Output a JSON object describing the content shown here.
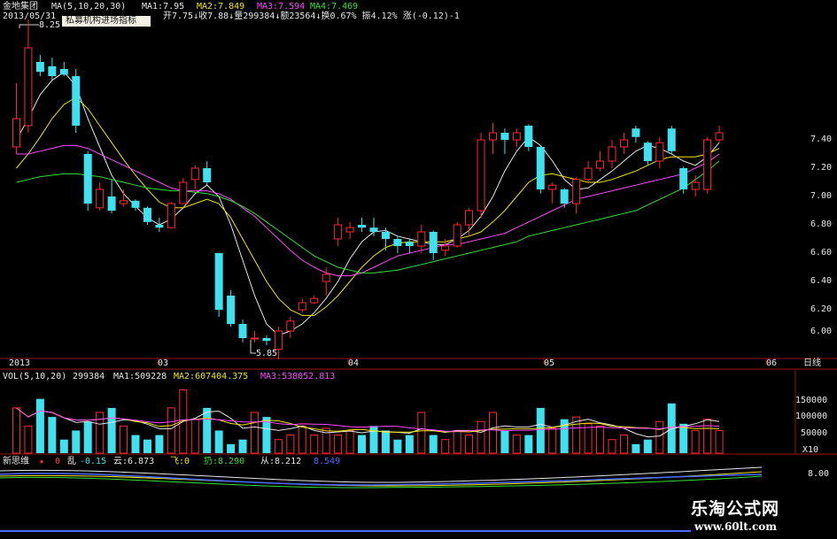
{
  "header": {
    "stock_name": "金地集团",
    "date": "2013/05/31",
    "ma_label": "MA(5,10,20,30)",
    "ma1": "MA1:7.95",
    "ma2": "MA2:7.849",
    "ma3": "MA3:7.594",
    "ma4": "MA4:7.469",
    "quote_line": "开7.75↓收7.88↓量299384↓额23564↓换0.67%  振4.12% 涨(-0.12)-1",
    "tooltip": "私募机构进场指标",
    "high_label": "8.25",
    "low_label": "5.85"
  },
  "vol_header": {
    "label": "VOL(5,10,20)",
    "value": "299384",
    "ma1": "MA1:509228",
    "ma2": "MA2:607404.375",
    "ma3": "MA3:538052.813"
  },
  "ind_header": {
    "label": "新思维",
    "star": "★",
    "zero": "0",
    "luan": "乱",
    "luan_val": "-0.15",
    "yun": "云:6.873",
    "fei": "飞:0",
    "zha": "扔:8.290",
    "cong": "从:8.212",
    "blue": "8.549"
  },
  "axis": {
    "period_label": "日线",
    "x10_label": "X10",
    "x_ticks": [
      "2013",
      "03",
      "04",
      "05",
      "06"
    ],
    "price_ticks": [
      "7.40",
      "7.20",
      "7.00",
      "6.80",
      "6.60",
      "6.40",
      "6.20",
      "6.00"
    ],
    "vol_ticks": [
      "150000",
      "100000",
      "50000"
    ],
    "ind_tick": "8.00"
  },
  "watermark": {
    "cn": "乐淘公式网",
    "url": "www.60lt.com"
  },
  "colors": {
    "up": "#ff2a2a",
    "down": "#3fe0f0",
    "ma1": "#e6e6e6",
    "ma2": "#f2e600",
    "ma3": "#ff48ff",
    "ma4": "#32e032"
  },
  "chart_data": {
    "type": "candlestick",
    "candles": [
      {
        "o": 7.35,
        "h": 7.8,
        "l": 7.3,
        "c": 7.55
      },
      {
        "o": 7.5,
        "h": 8.25,
        "l": 7.45,
        "c": 8.05
      },
      {
        "o": 7.95,
        "h": 8.0,
        "l": 7.85,
        "c": 7.88
      },
      {
        "o": 7.92,
        "h": 7.98,
        "l": 7.82,
        "c": 7.85
      },
      {
        "o": 7.9,
        "h": 7.95,
        "l": 7.85,
        "c": 7.86
      },
      {
        "o": 7.85,
        "h": 7.9,
        "l": 7.45,
        "c": 7.5
      },
      {
        "o": 7.3,
        "h": 7.32,
        "l": 6.9,
        "c": 6.95
      },
      {
        "o": 6.92,
        "h": 7.1,
        "l": 6.9,
        "c": 7.05
      },
      {
        "o": 7.0,
        "h": 7.12,
        "l": 6.88,
        "c": 6.9
      },
      {
        "o": 6.95,
        "h": 7.05,
        "l": 6.93,
        "c": 6.97
      },
      {
        "o": 6.97,
        "h": 6.98,
        "l": 6.9,
        "c": 6.92
      },
      {
        "o": 6.92,
        "h": 6.93,
        "l": 6.8,
        "c": 6.82
      },
      {
        "o": 6.8,
        "h": 6.85,
        "l": 6.75,
        "c": 6.78
      },
      {
        "o": 6.78,
        "h": 6.96,
        "l": 6.78,
        "c": 6.95
      },
      {
        "o": 6.95,
        "h": 7.13,
        "l": 6.95,
        "c": 7.1
      },
      {
        "o": 7.12,
        "h": 7.22,
        "l": 7.05,
        "c": 7.2
      },
      {
        "o": 7.2,
        "h": 7.25,
        "l": 7.08,
        "c": 7.1
      },
      {
        "o": 6.6,
        "h": 6.6,
        "l": 6.15,
        "c": 6.2
      },
      {
        "o": 6.3,
        "h": 6.34,
        "l": 6.08,
        "c": 6.1
      },
      {
        "o": 6.1,
        "h": 6.13,
        "l": 5.97,
        "c": 6.0
      },
      {
        "o": 6.0,
        "h": 6.05,
        "l": 5.97,
        "c": 6.0
      },
      {
        "o": 6.0,
        "h": 6.02,
        "l": 5.95,
        "c": 5.98
      },
      {
        "o": 5.92,
        "h": 6.08,
        "l": 5.85,
        "c": 6.05
      },
      {
        "o": 6.05,
        "h": 6.15,
        "l": 6.0,
        "c": 6.12
      },
      {
        "o": 6.2,
        "h": 6.28,
        "l": 6.18,
        "c": 6.25
      },
      {
        "o": 6.25,
        "h": 6.3,
        "l": 6.24,
        "c": 6.28
      },
      {
        "o": 6.4,
        "h": 6.5,
        "l": 6.3,
        "c": 6.45
      },
      {
        "o": 6.7,
        "h": 6.85,
        "l": 6.65,
        "c": 6.8
      },
      {
        "o": 6.75,
        "h": 6.82,
        "l": 6.7,
        "c": 6.78
      },
      {
        "o": 6.8,
        "h": 6.85,
        "l": 6.75,
        "c": 6.78
      },
      {
        "o": 6.78,
        "h": 6.85,
        "l": 6.72,
        "c": 6.75
      },
      {
        "o": 6.75,
        "h": 6.78,
        "l": 6.62,
        "c": 6.7
      },
      {
        "o": 6.7,
        "h": 6.72,
        "l": 6.6,
        "c": 6.65
      },
      {
        "o": 6.68,
        "h": 6.7,
        "l": 6.6,
        "c": 6.65
      },
      {
        "o": 6.65,
        "h": 6.8,
        "l": 6.6,
        "c": 6.75
      },
      {
        "o": 6.75,
        "h": 6.76,
        "l": 6.55,
        "c": 6.6
      },
      {
        "o": 6.62,
        "h": 6.7,
        "l": 6.58,
        "c": 6.65
      },
      {
        "o": 6.65,
        "h": 6.82,
        "l": 6.64,
        "c": 6.8
      },
      {
        "o": 6.8,
        "h": 6.92,
        "l": 6.72,
        "c": 6.9
      },
      {
        "o": 6.9,
        "h": 7.45,
        "l": 6.85,
        "c": 7.4
      },
      {
        "o": 7.4,
        "h": 7.52,
        "l": 7.3,
        "c": 7.45
      },
      {
        "o": 7.45,
        "h": 7.48,
        "l": 7.3,
        "c": 7.4
      },
      {
        "o": 7.4,
        "h": 7.48,
        "l": 7.35,
        "c": 7.45
      },
      {
        "o": 7.5,
        "h": 7.51,
        "l": 7.32,
        "c": 7.35
      },
      {
        "o": 7.35,
        "h": 7.36,
        "l": 7.02,
        "c": 7.05
      },
      {
        "o": 7.05,
        "h": 7.1,
        "l": 6.95,
        "c": 7.08
      },
      {
        "o": 7.05,
        "h": 7.06,
        "l": 6.92,
        "c": 6.95
      },
      {
        "o": 6.95,
        "h": 7.14,
        "l": 6.88,
        "c": 7.12
      },
      {
        "o": 7.12,
        "h": 7.25,
        "l": 7.1,
        "c": 7.2
      },
      {
        "o": 7.2,
        "h": 7.32,
        "l": 7.18,
        "c": 7.25
      },
      {
        "o": 7.25,
        "h": 7.4,
        "l": 7.2,
        "c": 7.35
      },
      {
        "o": 7.35,
        "h": 7.45,
        "l": 7.3,
        "c": 7.4
      },
      {
        "o": 7.48,
        "h": 7.5,
        "l": 7.38,
        "c": 7.42
      },
      {
        "o": 7.38,
        "h": 7.39,
        "l": 7.22,
        "c": 7.25
      },
      {
        "o": 7.25,
        "h": 7.42,
        "l": 7.2,
        "c": 7.38
      },
      {
        "o": 7.48,
        "h": 7.5,
        "l": 7.3,
        "c": 7.32
      },
      {
        "o": 7.2,
        "h": 7.21,
        "l": 7.02,
        "c": 7.05
      },
      {
        "o": 7.05,
        "h": 7.15,
        "l": 7.0,
        "c": 7.1
      },
      {
        "o": 7.05,
        "h": 7.42,
        "l": 7.02,
        "c": 7.4
      },
      {
        "o": 7.4,
        "h": 7.5,
        "l": 7.38,
        "c": 7.45
      }
    ],
    "ma_lines": [
      {
        "name": "MA1",
        "values": [
          7.4,
          7.55,
          7.72,
          7.82,
          7.88,
          7.78,
          7.55,
          7.35,
          7.15,
          7.02,
          6.93,
          6.85,
          6.8,
          6.84,
          6.92,
          7.02,
          7.08,
          7.0,
          6.8,
          6.55,
          6.3,
          6.1,
          6.02,
          6.05,
          6.1,
          6.18,
          6.28,
          6.4,
          6.56,
          6.68,
          6.75,
          6.76,
          6.72,
          6.7,
          6.68,
          6.66,
          6.66,
          6.7,
          6.76,
          6.86,
          7.0,
          7.18,
          7.32,
          7.42,
          7.36,
          7.25,
          7.12,
          7.05,
          7.06,
          7.12,
          7.18,
          7.25,
          7.32,
          7.36,
          7.34,
          7.3,
          7.25,
          7.22,
          7.28,
          7.38
        ]
      },
      {
        "name": "MA2",
        "values": [
          7.2,
          7.3,
          7.42,
          7.55,
          7.65,
          7.7,
          7.62,
          7.5,
          7.38,
          7.26,
          7.15,
          7.05,
          6.96,
          6.92,
          6.92,
          6.95,
          6.98,
          6.95,
          6.85,
          6.7,
          6.55,
          6.4,
          6.28,
          6.2,
          6.16,
          6.16,
          6.22,
          6.3,
          6.4,
          6.5,
          6.58,
          6.64,
          6.67,
          6.68,
          6.68,
          6.68,
          6.68,
          6.7,
          6.72,
          6.75,
          6.82,
          6.9,
          7.0,
          7.1,
          7.15,
          7.16,
          7.14,
          7.12,
          7.1,
          7.1,
          7.12,
          7.15,
          7.18,
          7.22,
          7.26,
          7.28,
          7.28,
          7.28,
          7.3,
          7.34
        ]
      },
      {
        "name": "MA3",
        "values": [
          7.3,
          7.3,
          7.32,
          7.34,
          7.36,
          7.36,
          7.34,
          7.3,
          7.26,
          7.22,
          7.18,
          7.14,
          7.1,
          7.06,
          7.04,
          7.04,
          7.04,
          7.02,
          6.98,
          6.92,
          6.86,
          6.78,
          6.7,
          6.62,
          6.55,
          6.5,
          6.46,
          6.44,
          6.44,
          6.46,
          6.5,
          6.54,
          6.58,
          6.6,
          6.62,
          6.64,
          6.66,
          6.66,
          6.68,
          6.7,
          6.72,
          6.74,
          6.78,
          6.82,
          6.86,
          6.9,
          6.94,
          6.98,
          7.0,
          7.02,
          7.04,
          7.06,
          7.08,
          7.1,
          7.12,
          7.14,
          7.16,
          7.2,
          7.24,
          7.3
        ]
      },
      {
        "name": "MA4",
        "values": [
          7.1,
          7.12,
          7.14,
          7.15,
          7.16,
          7.16,
          7.15,
          7.14,
          7.12,
          7.1,
          7.08,
          7.06,
          7.05,
          7.04,
          7.04,
          7.03,
          7.02,
          7.0,
          6.97,
          6.93,
          6.88,
          6.82,
          6.76,
          6.7,
          6.64,
          6.58,
          6.54,
          6.5,
          6.48,
          6.46,
          6.46,
          6.47,
          6.48,
          6.5,
          6.52,
          6.54,
          6.56,
          6.58,
          6.6,
          6.62,
          6.64,
          6.66,
          6.68,
          6.72,
          6.74,
          6.76,
          6.78,
          6.8,
          6.82,
          6.84,
          6.86,
          6.88,
          6.9,
          6.94,
          6.98,
          7.02,
          7.06,
          7.12,
          7.18,
          7.25
        ]
      }
    ],
    "volume": [
      100000,
      60000,
      120000,
      80000,
      30000,
      50000,
      70000,
      90000,
      100000,
      60000,
      40000,
      30000,
      40000,
      100000,
      140000,
      75000,
      100000,
      50000,
      20000,
      30000,
      90000,
      80000,
      30000,
      40000,
      60000,
      40000,
      55000,
      40000,
      50000,
      40000,
      60000,
      50000,
      30000,
      40000,
      90000,
      40000,
      30000,
      50000,
      40000,
      70000,
      90000,
      50000,
      40000,
      40000,
      100000,
      55000,
      75000,
      80000,
      65000,
      60000,
      30000,
      40000,
      20000,
      30000,
      70000,
      110000,
      65000,
      50000,
      75000,
      50000
    ],
    "volume_ylim": [
      0,
      180000
    ],
    "indicator": {
      "tick": "8.00"
    }
  }
}
